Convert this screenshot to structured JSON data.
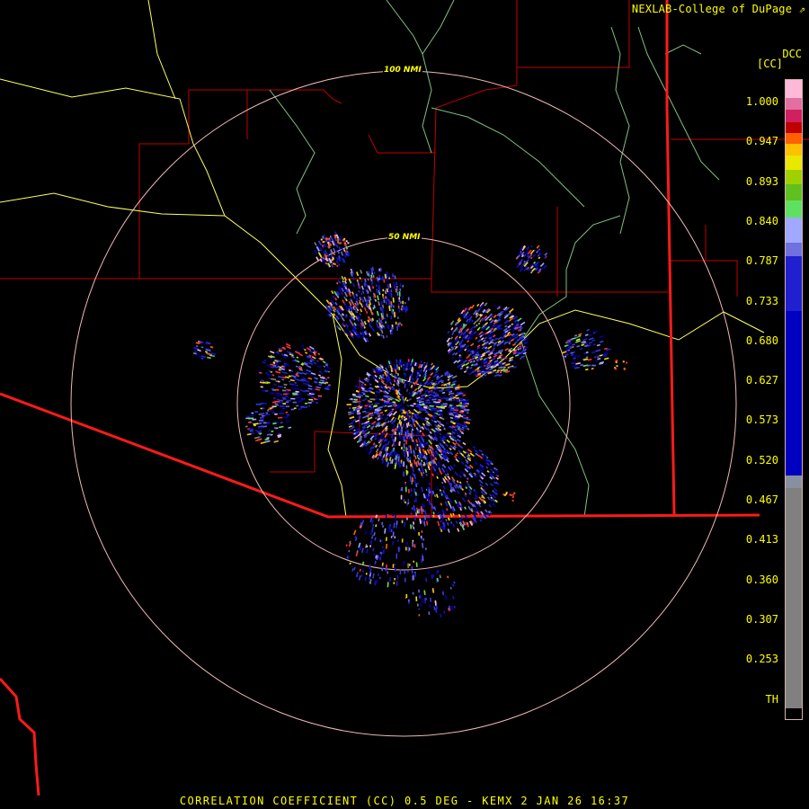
{
  "header": {
    "credit": "NEXLAB-College of DuPage"
  },
  "legend": {
    "product_code": "DCC",
    "unit": "[CC]",
    "labels": [
      "1.000",
      "0.947",
      "0.893",
      "0.840",
      "0.787",
      "0.733",
      "0.680",
      "0.627",
      "0.573",
      "0.520",
      "0.467",
      "0.413",
      "0.360",
      "0.307",
      "0.253",
      "TH"
    ],
    "colors": [
      "#ffb8d8",
      "#e070a0",
      "#d02060",
      "#c00000",
      "#ff6000",
      "#ffc000",
      "#e8e800",
      "#a0d000",
      "#60c020",
      "#60e060",
      "#a0a8ff",
      "#7070e0",
      "#2020d0",
      "#0000c0",
      "#8890a0",
      "#808080",
      "#000000"
    ]
  },
  "rings": [
    {
      "label": "100 NMI"
    },
    {
      "label": "50 NMI"
    }
  ],
  "footer": {
    "caption": "CORRELATION COEFFICIENT (CC) 0.5 DEG - KEMX 2 JAN 26 16:37"
  },
  "colors": {
    "state_border": "#ff1a1a",
    "county_border": "#c00000",
    "highway": "#ffff60",
    "river": "#80c080",
    "range_ring": "#f0b8b8",
    "text": "#ffff00",
    "background": "#000000"
  }
}
